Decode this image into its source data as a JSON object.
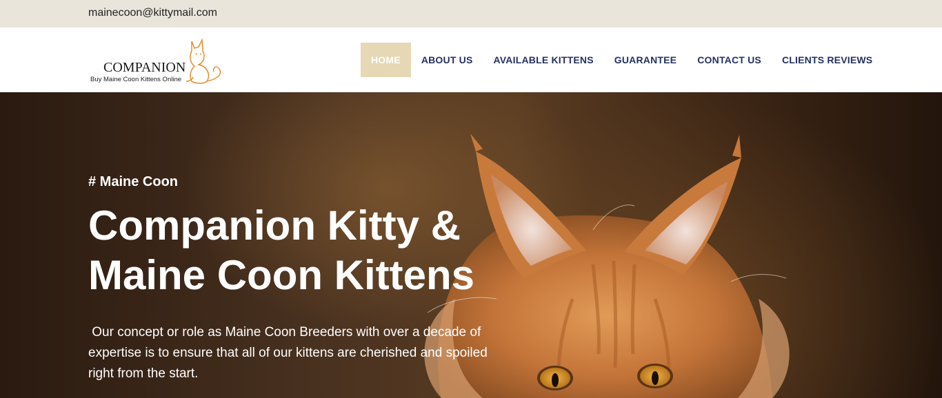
{
  "topbar": {
    "email": "mainecoon@kittymail.com"
  },
  "logo": {
    "brand": "COMPANION",
    "tagline": "Buy Maine Coon Kittens Online",
    "accent_color": "#e5861f",
    "brand_color": "#1a1a1a"
  },
  "nav": {
    "items": [
      {
        "label": "HOME",
        "active": true
      },
      {
        "label": "ABOUT US",
        "active": false
      },
      {
        "label": "AVAILABLE KITTENS",
        "active": false
      },
      {
        "label": "GUARANTEE",
        "active": false
      },
      {
        "label": "CONTACT US",
        "active": false
      },
      {
        "label": "CLIENTS REVIEWS",
        "active": false
      }
    ],
    "active_bg": "#e6d8b4",
    "text_color": "#233163"
  },
  "hero": {
    "tag": "# Maine Coon",
    "title": "Companion Kitty & Maine Coon Kittens",
    "text": " Our concept or role as Maine Coon Breeders with over a decade of expertise is to ensure that all of our kittens are cherished and spoiled right from the start.",
    "image": "maine-coon-cat-photo"
  }
}
